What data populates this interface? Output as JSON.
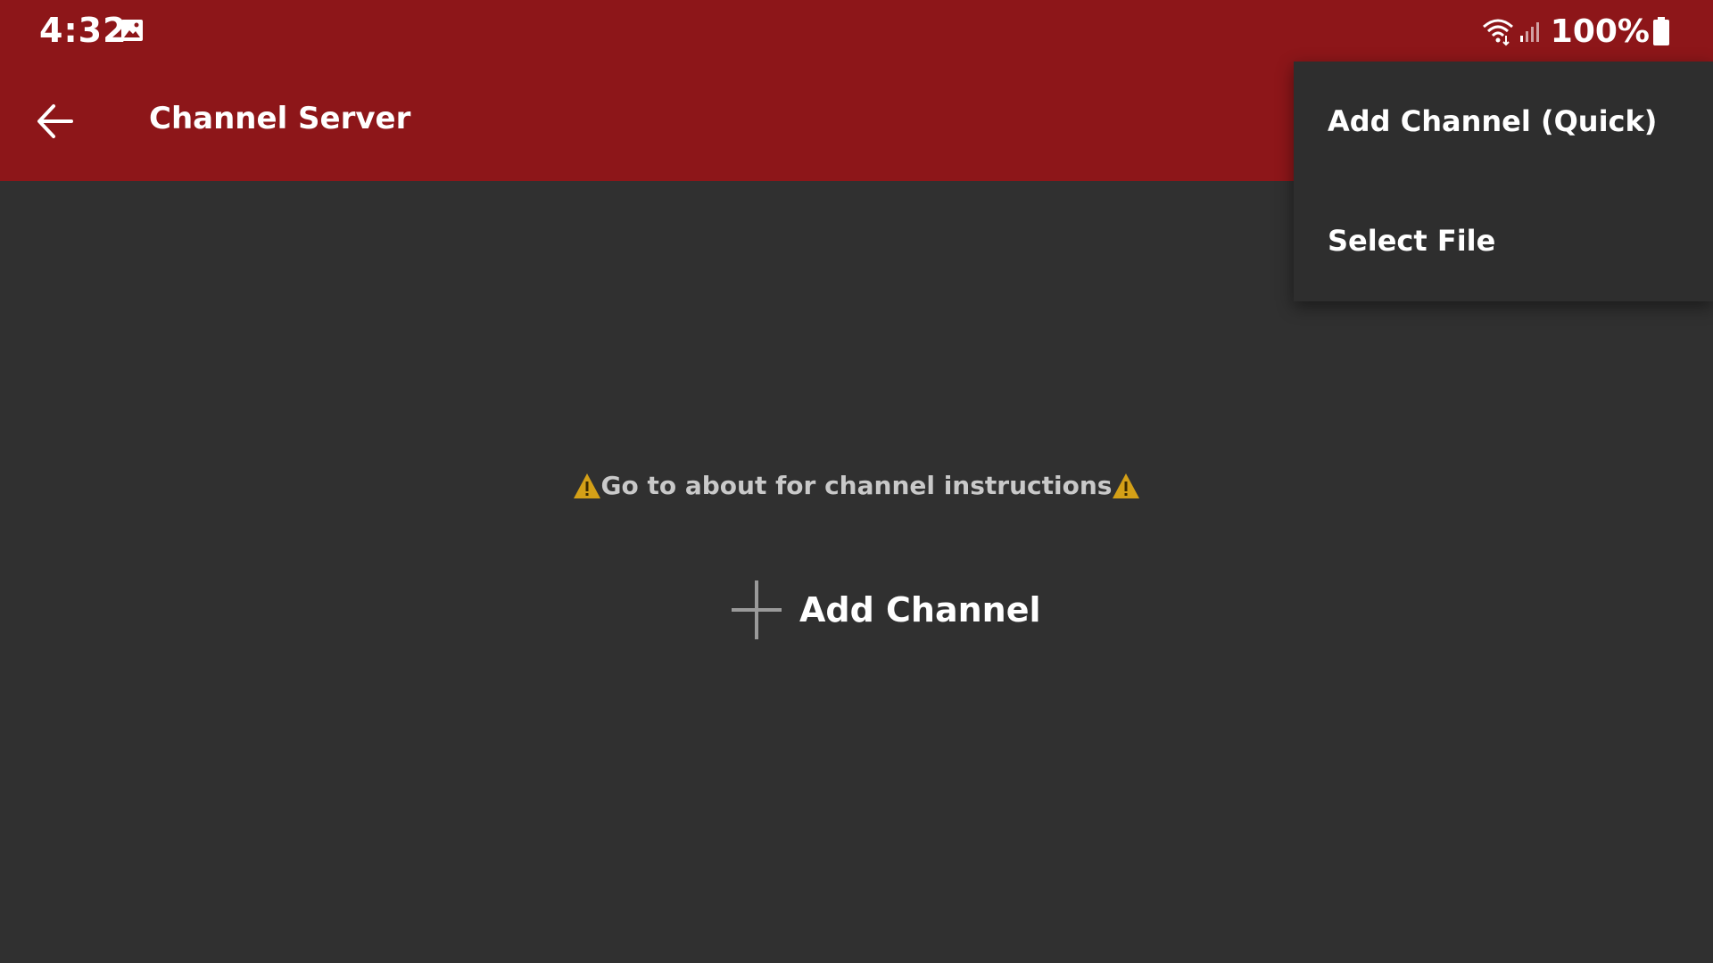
{
  "status_bar": {
    "time": "4:32",
    "battery": "100%",
    "icons": [
      "gallery-icon",
      "wifi-icon",
      "signal-icon",
      "battery-icon"
    ]
  },
  "app_bar": {
    "title": "Channel Server",
    "back_icon": "back-arrow-icon"
  },
  "content": {
    "instructions": "Go to about for channel instructions",
    "add_channel_label": "Add Channel"
  },
  "menu": {
    "items": [
      {
        "label": "Add Channel (Quick)"
      },
      {
        "label": "Select File"
      }
    ]
  },
  "colors": {
    "header": "#8d1619",
    "background": "#303030",
    "menu": "#2e2e2e",
    "warning": "#d4a017"
  }
}
